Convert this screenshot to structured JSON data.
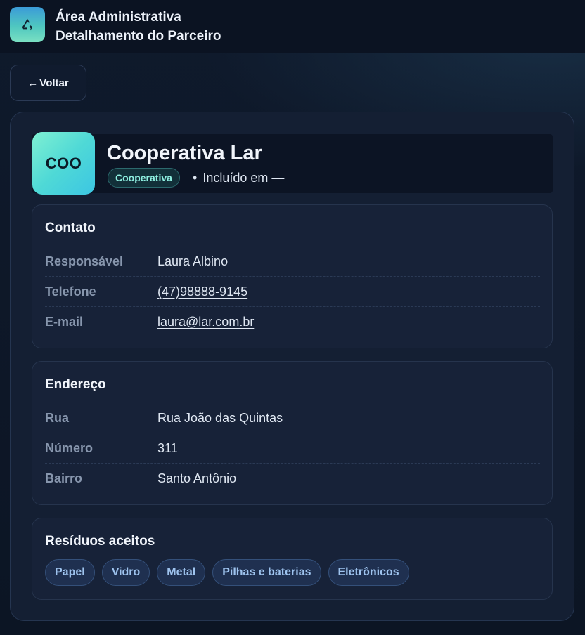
{
  "header": {
    "title": "Área Administrativa",
    "subtitle": "Detalhamento do Parceiro",
    "logo_icon": "recycle-icon"
  },
  "back_button": {
    "arrow": "←",
    "label": "Voltar"
  },
  "partner": {
    "avatar_text": "COO",
    "name": "Cooperativa Lar",
    "type_badge": "Cooperativa",
    "bullet": "•",
    "included_text": "Incluído em —"
  },
  "contact": {
    "title": "Contato",
    "rows": [
      {
        "label": "Responsável",
        "value": "Laura Albino"
      },
      {
        "label": "Telefone",
        "value": "(47)98888-9145"
      },
      {
        "label": "E-mail",
        "value": "laura@lar.com.br"
      }
    ]
  },
  "address": {
    "title": "Endereço",
    "rows": [
      {
        "label": "Rua",
        "value": "Rua João das Quintas"
      },
      {
        "label": "Número",
        "value": "311"
      },
      {
        "label": "Bairro",
        "value": "Santo Antônio"
      }
    ]
  },
  "waste": {
    "title": "Resíduos aceitos",
    "items": [
      "Papel",
      "Vidro",
      "Metal",
      "Pilhas e baterias",
      "Eletrônicos"
    ]
  },
  "colors": {
    "background": "#0d1626",
    "card": "#141f33",
    "accent_teal": "#8ff0e1",
    "chip_text": "#9ec3ee"
  }
}
